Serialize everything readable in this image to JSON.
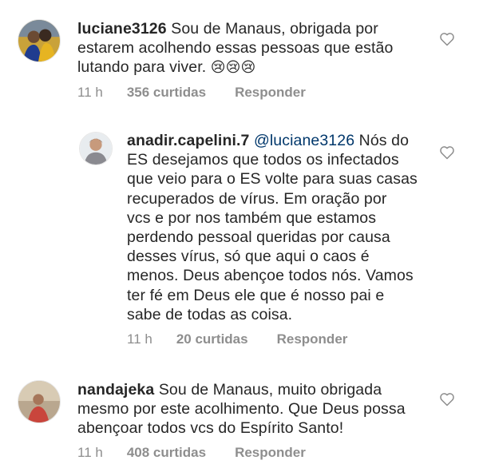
{
  "comments": [
    {
      "username": "luciane3126",
      "lines": [
        "Sou de Manaus, obrigada por",
        "estarem acolhendo essas pessoas que estão",
        "lutando para viver. "
      ],
      "emoji": "😢😢😢",
      "time": "11 h",
      "likes": "356 curtidas",
      "reply": "Responder",
      "like_icon": "heart-outline-icon"
    },
    {
      "username": "anadir.capelini.7",
      "mention": "@luciane3126",
      "lines": [
        "Nós do",
        "ES desejamos que todos os infectados",
        "que veio para o ES volte para suas casas",
        "recuperados de vírus. Em oração por",
        "vcs e por nos também que estamos",
        "perdendo pessoal queridas por causa",
        "desses vírus, só que aqui o caos é",
        "menos. Deus abençoe todos nós. Vamos",
        "ter fé em Deus ele que é nosso pai e",
        "sabe de todas as coisa."
      ],
      "time": "11 h",
      "likes": "20 curtidas",
      "reply": "Responder",
      "like_icon": "heart-outline-icon"
    },
    {
      "username": "nandajeka",
      "lines": [
        "Sou de Manaus, muito obrigada",
        "mesmo por este acolhimento. Que Deus possa",
        "abençoar todos vcs do Espírito Santo!"
      ],
      "time": "11 h",
      "likes": "408 curtidas",
      "reply": "Responder",
      "like_icon": "heart-outline-icon"
    }
  ],
  "colors": {
    "text": "#262626",
    "meta": "#8e8e8e",
    "mention": "#00376b"
  }
}
